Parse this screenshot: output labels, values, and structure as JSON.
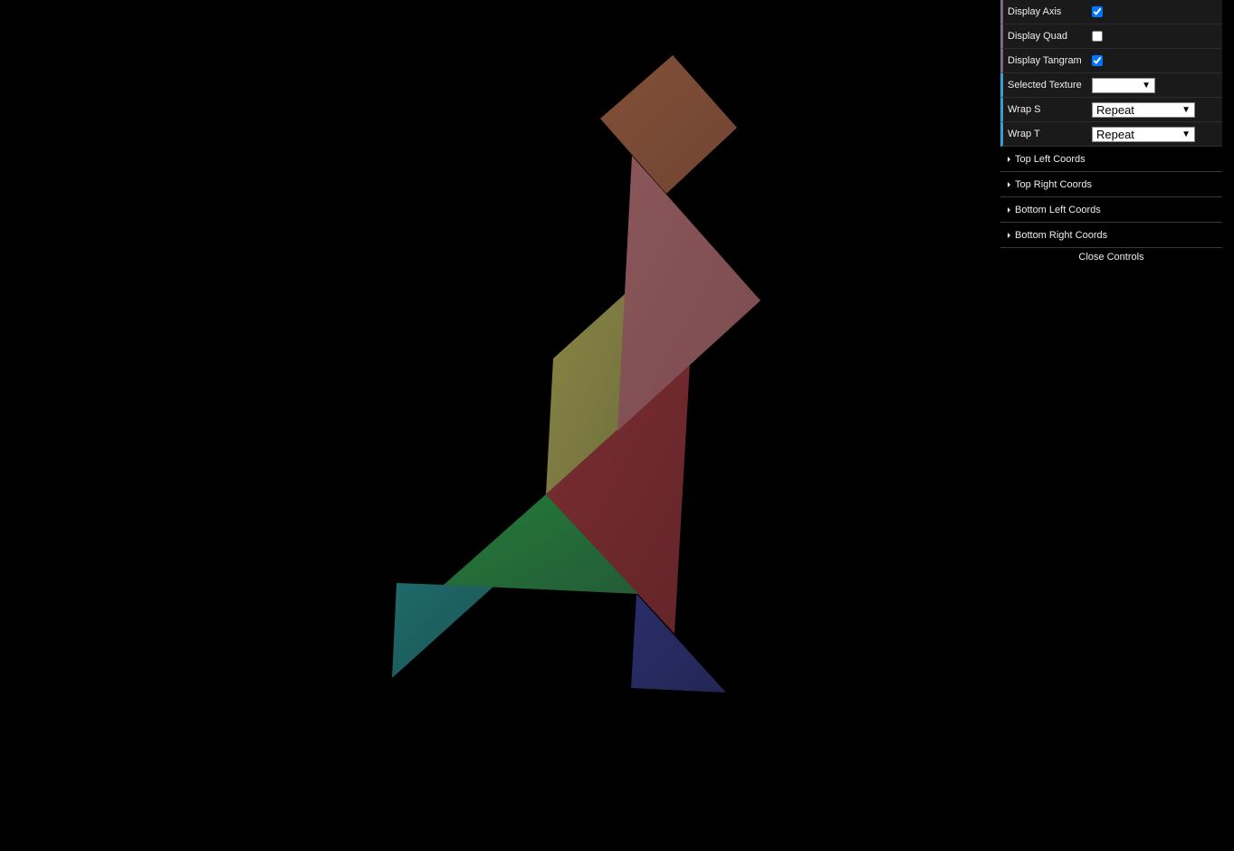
{
  "controls": {
    "display_axis": {
      "label": "Display Axis",
      "checked": true
    },
    "display_quad": {
      "label": "Display Quad",
      "checked": false
    },
    "display_tangram": {
      "label": "Display Tangram",
      "checked": true
    },
    "selected_texture": {
      "label": "Selected Texture",
      "value": ""
    },
    "wrap_s": {
      "label": "Wrap S",
      "value": "Repeat"
    },
    "wrap_t": {
      "label": "Wrap T",
      "value": "Repeat"
    }
  },
  "folders": {
    "top_left": "Top Left Coords",
    "top_right": "Top Right Coords",
    "bottom_left": "Bottom Left Coords",
    "bottom_right": "Bottom Right Coords"
  },
  "close_label": "Close Controls",
  "colors": {
    "square": "#7a4a36",
    "large_triangle_pink": "#845457",
    "large_triangle_red": "#6e2a2e",
    "parallelogram": "#7f7e42",
    "medium_triangle_green": "#24673a",
    "small_triangle_teal": "#1e5f5f",
    "small_triangle_blue": "#262a5e"
  }
}
